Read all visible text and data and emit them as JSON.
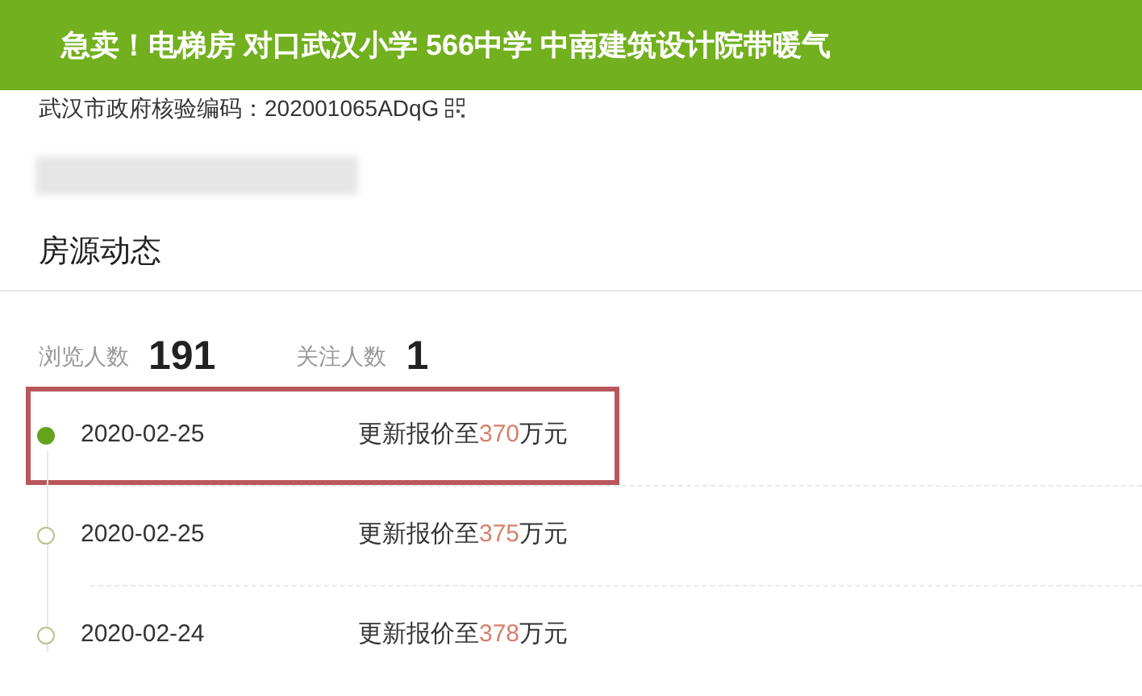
{
  "header": {
    "title": "急卖！电梯房 对口武汉小学 566中学 中南建筑设计院带暖气"
  },
  "verification": {
    "label": "武汉市政府核验编码：",
    "code": "202001065ADqG"
  },
  "section": {
    "title": "房源动态"
  },
  "stats": [
    {
      "label": "浏览人数",
      "value": "191"
    },
    {
      "label": "关注人数",
      "value": "1"
    }
  ],
  "timeline": [
    {
      "date": "2020-02-25",
      "text_before": "更新报价至",
      "price": "370",
      "text_after": "万元",
      "selected": true
    },
    {
      "date": "2020-02-25",
      "text_before": "更新报价至",
      "price": "375",
      "text_after": "万元",
      "selected": false
    },
    {
      "date": "2020-02-24",
      "text_before": "更新报价至",
      "price": "378",
      "text_after": "万元",
      "selected": false
    }
  ]
}
